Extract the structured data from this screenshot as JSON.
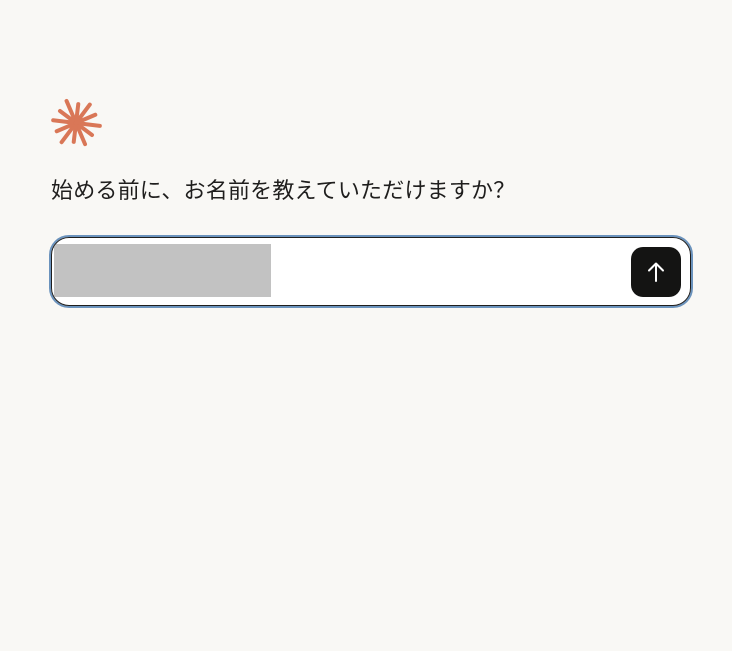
{
  "brand": {
    "logo_icon": "asterisk-burst-icon",
    "logo_color": "#d97757"
  },
  "onboarding": {
    "question": "始める前に、お名前を教えていただけますか？"
  },
  "name_form": {
    "input_value": "",
    "input_value_redacted": true,
    "submit_icon": "arrow-up-icon",
    "submit_bg_color": "#141413",
    "focus_ring_color": "#6b93bd"
  }
}
